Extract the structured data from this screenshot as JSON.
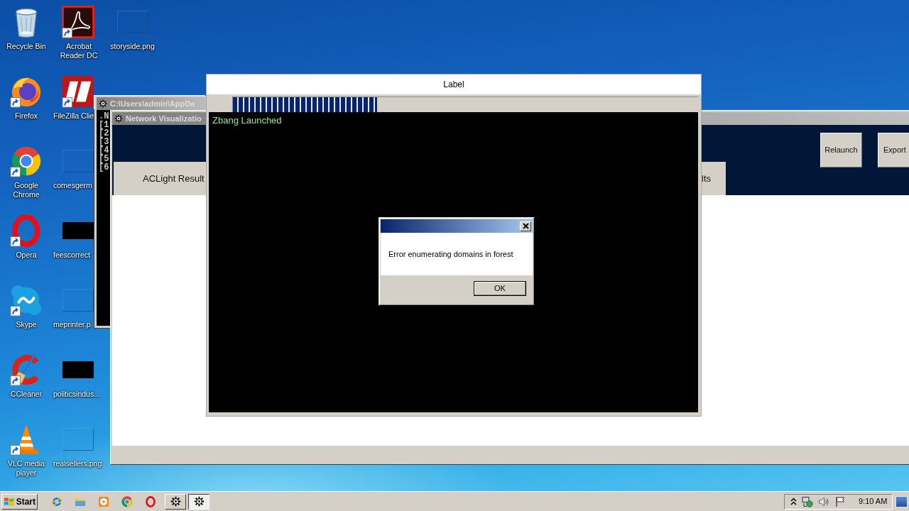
{
  "desktop_icons": [
    {
      "label": "Recycle Bin",
      "kind": "recyclebin",
      "shortcut": false
    },
    {
      "label": "Firefox",
      "kind": "foxbrowser",
      "shortcut": true
    },
    {
      "label": "Google Chrome",
      "kind": "ringbrowser",
      "shortcut": true
    },
    {
      "label": "Opera",
      "kind": "obrowser",
      "shortcut": true
    },
    {
      "label": "Skype",
      "kind": "chat",
      "shortcut": true
    },
    {
      "label": "CCleaner",
      "kind": "cleaner",
      "shortcut": true
    },
    {
      "label": "VLC media player",
      "kind": "mediaplayer",
      "shortcut": true
    },
    {
      "label": "Acrobat Reader DC",
      "kind": "pdfreader",
      "shortcut": true
    },
    {
      "label": "FileZilla Clie",
      "kind": "ftpclient",
      "shortcut": true
    },
    {
      "label": "comesgerm",
      "kind": "blankimage",
      "shortcut": false
    },
    {
      "label": "feescorrect",
      "kind": "darkimage",
      "shortcut": false
    },
    {
      "label": "meprinter.p",
      "kind": "blankimage",
      "shortcut": false
    },
    {
      "label": "politicsindus...",
      "kind": "darkimage",
      "shortcut": false
    },
    {
      "label": "realsellers.png",
      "kind": "blankimage",
      "shortcut": false
    },
    {
      "label": "storyside.png",
      "kind": "blankimage",
      "shortcut": false
    }
  ],
  "console_window": {
    "title": "C:\\Users\\admin\\AppDa",
    "lines": [
      ".N",
      "[1",
      "[2",
      "[3",
      "[4",
      "[5",
      "[6"
    ]
  },
  "network_window": {
    "title": "Network Visualizatio",
    "tabs": [
      {
        "label": "ACLight Result"
      },
      {
        "label": "lts"
      }
    ],
    "buttons": [
      "Relaunch",
      "Export"
    ]
  },
  "label_window": {
    "title": "Label",
    "progress": {
      "level": 0.31
    },
    "output": "Zbang Launched"
  },
  "error_dialog": {
    "message": "Error enumerating domains in forest",
    "buttons": [
      "OK"
    ]
  },
  "taskbar": {
    "start": "Start",
    "windows": [
      {
        "selected": false
      },
      {
        "selected": true
      }
    ],
    "clock": "9:10 AM"
  }
}
